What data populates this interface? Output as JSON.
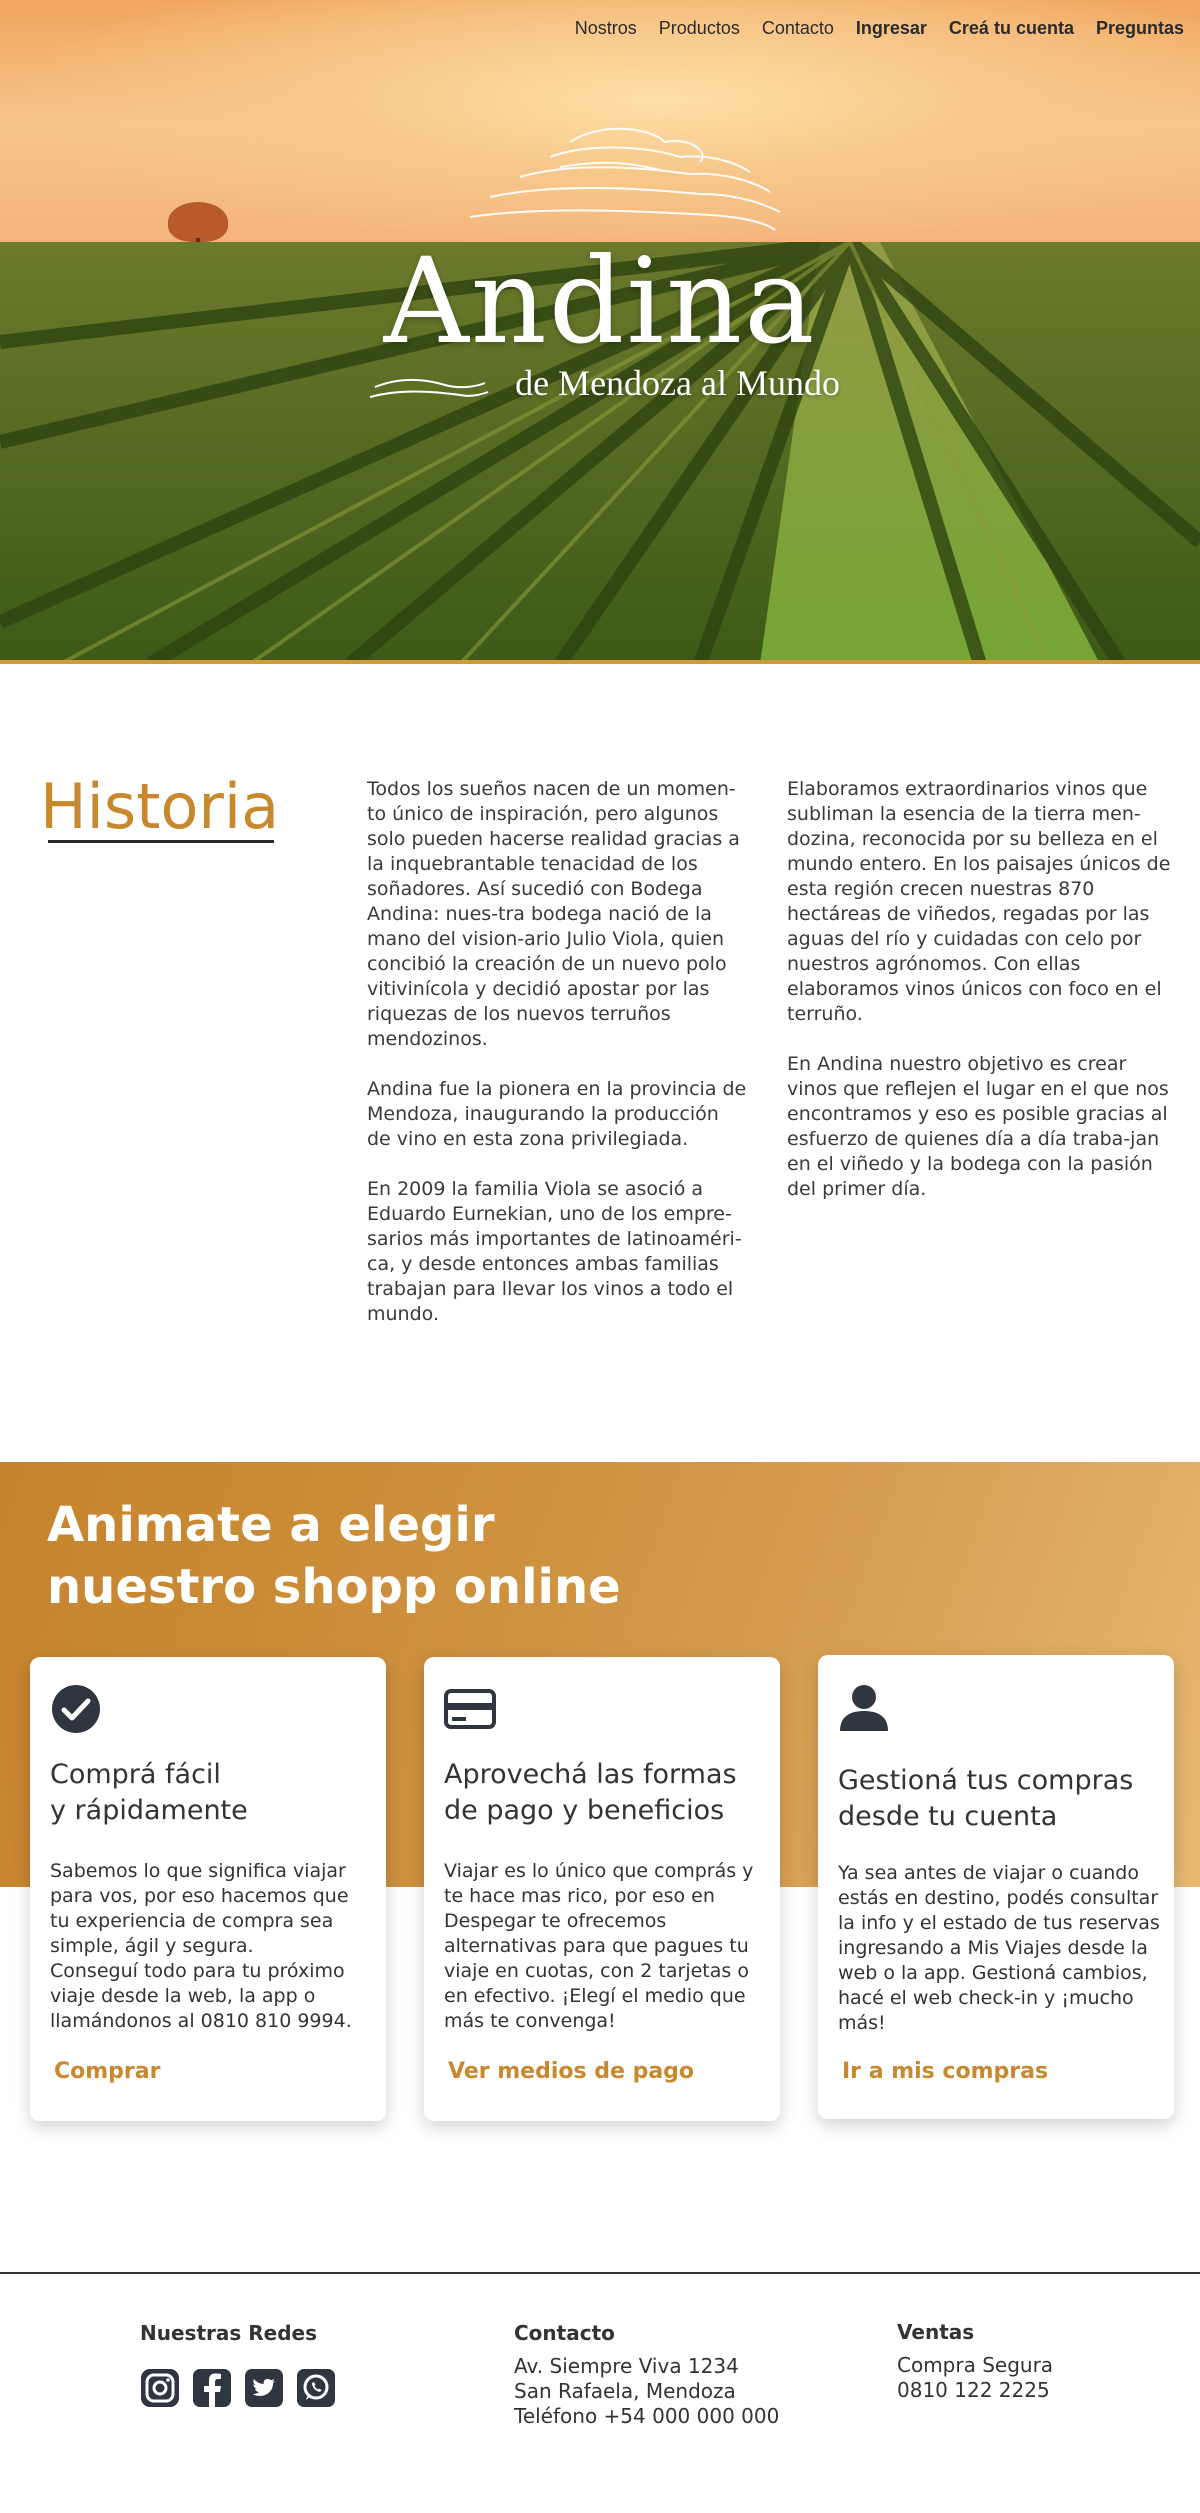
{
  "nav": {
    "items": [
      "Nostros",
      "Productos",
      "Contacto"
    ],
    "login": "Ingresar",
    "register": "Creá tu cuenta",
    "faq": "Preguntas"
  },
  "hero": {
    "brand": "Andina",
    "tagline": "de Mendoza al Mundo"
  },
  "historia": {
    "title": "Historia",
    "col1": [
      "Todos los sueños nacen de un momen-to único de inspiración, pero algunos solo pueden hacerse realidad gracias a la inquebrantable tenacidad de los soñadores. Así sucedió con Bodega Andina: nues-tra bodega nació de la mano del vision-ario Julio Viola, quien concibió la creación de un nuevo polo vitivinícola y decidió apostar por las riquezas de los nuevos terruños mendozinos.",
      "Andina fue la pionera en la provincia de Mendoza, inaugurando la producción de vino en esta zona privilegiada.",
      "En 2009 la familia Viola se asoció a Eduardo Eurnekian, uno de los empre-sarios más importantes de latinoaméri-ca, y desde entonces ambas familias trabajan para llevar los vinos a todo el mundo."
    ],
    "col2": [
      "Elaboramos extraordinarios vinos que subliman la esencia de la tierra men-dozina, reconocida por su belleza en el mundo entero. En los paisajes únicos de esta región crecen nuestras 870 hectáreas de viñedos, regadas por las aguas del río y cuidadas con celo por nuestros agrónomos. Con ellas elaboramos vinos únicos con foco en el terruño.",
      "En Andina nuestro objetivo es crear vinos que reflejen el lugar en el que nos encontramos y eso es posible gracias al esfuerzo de quienes día a día traba-jan en el viñedo y la bodega con la pasión del primer día."
    ]
  },
  "shop": {
    "title_line1": "Animate a elegir",
    "title_line2": "nuestro shopp online",
    "cards": [
      {
        "icon": "check-circle-icon",
        "title": "Comprá fácil\ny rápidamente",
        "text": "Sabemos lo que significa viajar para vos, por eso hacemos que tu experiencia de compra sea simple, ágil y segura.\nConseguí todo para tu próximo viaje desde la web, la app o llamándonos al 0810 810 9994.",
        "link": "Comprar"
      },
      {
        "icon": "credit-card-icon",
        "title": "Aprovechá las formas\nde pago y beneficios",
        "text": "Viajar es lo único que comprás y te hace mas rico, por eso en Despegar te ofrecemos alternativas para que pagues tu viaje en cuotas, con 2 tarjetas o en efectivo. ¡Elegí el medio que más te convenga!",
        "link": "Ver medios de pago"
      },
      {
        "icon": "user-icon",
        "title": "Gestioná tus compras\ndesde tu cuenta",
        "text": "Ya sea antes de viajar o cuando estás en destino, podés consultar la info y el estado de tus reservas ingresando a Mis Viajes desde la web o la app. Gestioná cambios, hacé el web check-in y ¡mucho más!",
        "link": "Ir a mis compras"
      }
    ]
  },
  "footer": {
    "redes_title": "Nuestras Redes",
    "social_icons": [
      "instagram-icon",
      "facebook-icon",
      "twitter-icon",
      "whatsapp-icon"
    ],
    "contacto_title": "Contacto",
    "contacto_lines": [
      "Av. Siempre Viva 1234",
      "San Rafaela, Mendoza",
      "Teléfono +54 000 000 000"
    ],
    "ventas_title": "Ventas",
    "ventas_lines": [
      "Compra Segura",
      "0810 122 2225"
    ]
  },
  "colors": {
    "accent": "#c8892e",
    "text": "#333333",
    "card_bg": "#ffffff"
  }
}
